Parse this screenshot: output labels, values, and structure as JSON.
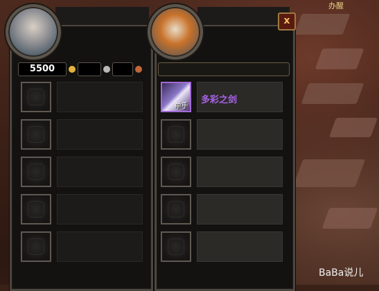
{
  "background": {
    "top_right_label": "办醒"
  },
  "trade_window": {
    "close_button": "x",
    "player": {
      "gold": "5500"
    },
    "partner": {
      "items": [
        {
          "name": "多彩之剑",
          "type_label": "单手",
          "quality_color": "#a862e6"
        }
      ]
    }
  },
  "watermark": "BaBa说儿"
}
